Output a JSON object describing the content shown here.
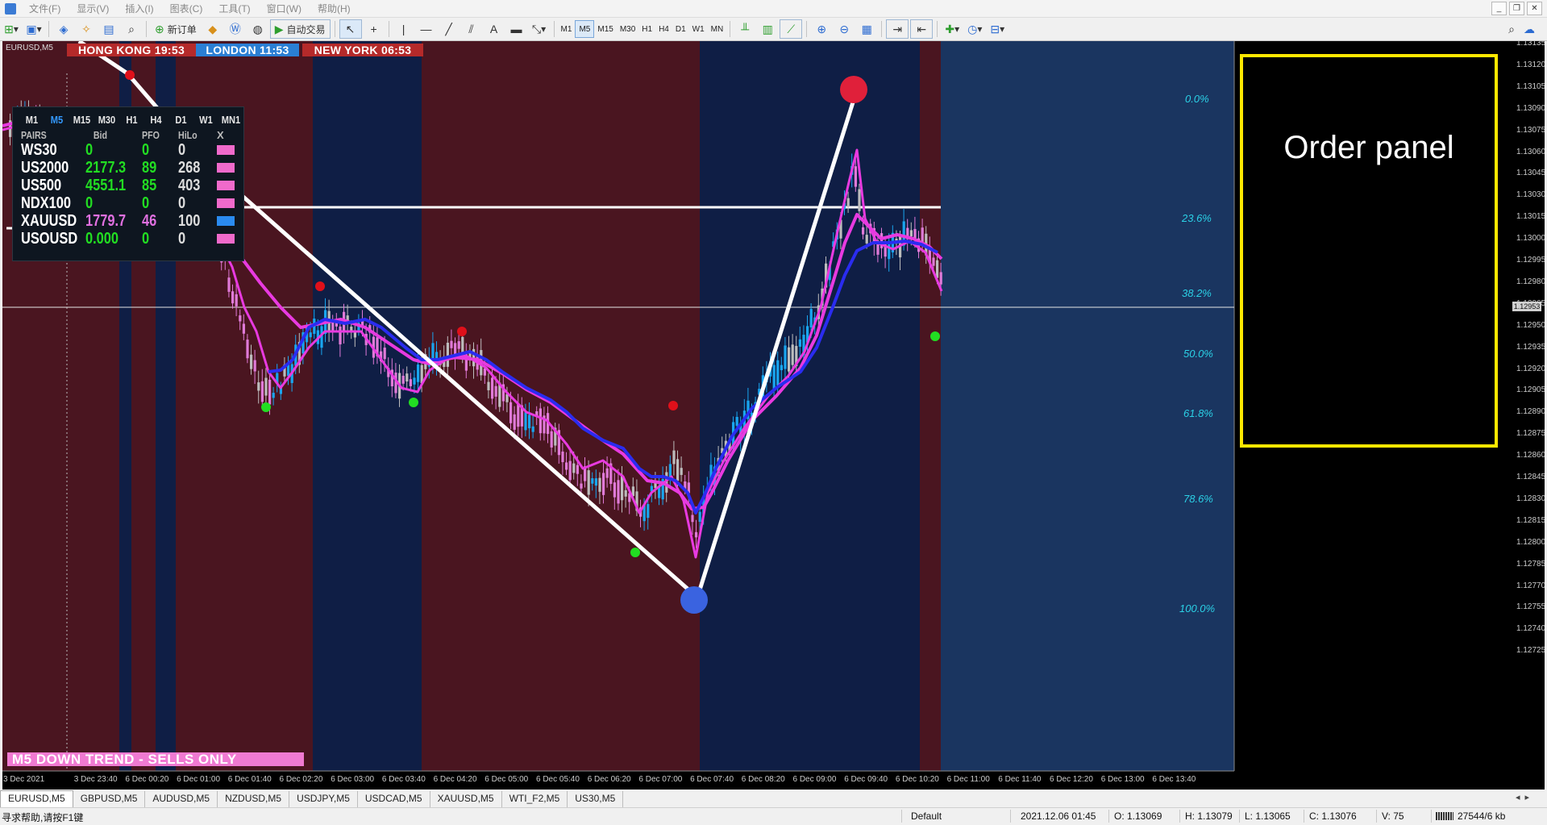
{
  "menu": [
    "文件(F)",
    "显示(V)",
    "插入(I)",
    "图表(C)",
    "工具(T)",
    "窗口(W)",
    "帮助(H)"
  ],
  "toolbar": {
    "new_order_label": "新订单",
    "auto_trade_label": "自动交易",
    "timeframes": [
      "M1",
      "M5",
      "M15",
      "M30",
      "H1",
      "H4",
      "D1",
      "W1",
      "MN"
    ],
    "active_timeframe": "M5"
  },
  "chart": {
    "symbol_label": "EURUSD,M5",
    "sessions": [
      {
        "label": "HONG KONG  19:53",
        "color": "#b52a2a"
      },
      {
        "label": "LONDON  11:53",
        "color": "#2a7fd4"
      },
      {
        "label": "NEW YORK  06:53",
        "color": "#b52a2a"
      }
    ],
    "order_panel_label": "Order panel",
    "trend_banner": "M5  DOWN TREND - SELLS ONLY",
    "fib_levels": [
      "0.0%",
      "23.6%",
      "38.2%",
      "50.0%",
      "61.8%",
      "78.6%",
      "100.0%"
    ],
    "price_axis": [
      "1.13135",
      "1.13120",
      "1.13105",
      "1.13090",
      "1.13075",
      "1.13060",
      "1.13045",
      "1.13030",
      "1.13015",
      "1.13000",
      "1.12995",
      "1.12980",
      "1.12965",
      "1.12950",
      "1.12935",
      "1.12920",
      "1.12905",
      "1.12890",
      "1.12875",
      "1.12860",
      "1.12845",
      "1.12830",
      "1.12815",
      "1.12800",
      "1.12785",
      "1.12770",
      "1.12755",
      "1.12740",
      "1.12725"
    ],
    "current_price": "1.12953",
    "time_axis": [
      "3 Dec 2021",
      "3 Dec 23:40",
      "6 Dec 00:20",
      "6 Dec 01:00",
      "6 Dec 01:40",
      "6 Dec 02:20",
      "6 Dec 03:00",
      "6 Dec 03:40",
      "6 Dec 04:20",
      "6 Dec 05:00",
      "6 Dec 05:40",
      "6 Dec 06:20",
      "6 Dec 07:00",
      "6 Dec 07:40",
      "6 Dec 08:20",
      "6 Dec 09:00",
      "6 Dec 09:40",
      "6 Dec 10:20",
      "6 Dec 11:00",
      "6 Dec 11:40",
      "6 Dec 12:20",
      "6 Dec 13:00",
      "6 Dec 13:40"
    ]
  },
  "overview": {
    "timeframes": [
      "M1",
      "M5",
      "M15",
      "M30",
      "H1",
      "H4",
      "D1",
      "W1",
      "MN1"
    ],
    "active_timeframe": "M5",
    "headers": {
      "pairs": "PAIRS",
      "bid": "Bid",
      "pfo": "PFO",
      "hilo": "HiLo",
      "x": "X"
    },
    "rows": [
      {
        "pair": "WS30",
        "bid": "0",
        "pfo": "0",
        "hilo": "0",
        "bid_color": "#22dd22",
        "pfo_color": "#22dd22",
        "x_color": "#f06acb"
      },
      {
        "pair": "US2000",
        "bid": "2177.3",
        "pfo": "89",
        "hilo": "268",
        "bid_color": "#22dd22",
        "pfo_color": "#22dd22",
        "x_color": "#f06acb"
      },
      {
        "pair": "US500",
        "bid": "4551.1",
        "pfo": "85",
        "hilo": "403",
        "bid_color": "#22dd22",
        "pfo_color": "#22dd22",
        "x_color": "#f06acb"
      },
      {
        "pair": "NDX100",
        "bid": "0",
        "pfo": "0",
        "hilo": "0",
        "bid_color": "#22dd22",
        "pfo_color": "#22dd22",
        "x_color": "#f06acb"
      },
      {
        "pair": "XAUUSD",
        "bid": "1779.7",
        "pfo": "46",
        "hilo": "100",
        "bid_color": "#e070e0",
        "pfo_color": "#e070e0",
        "x_color": "#2a8bf0"
      },
      {
        "pair": "USOUSD",
        "bid": "0.000",
        "pfo": "0",
        "hilo": "0",
        "bid_color": "#22dd22",
        "pfo_color": "#22dd22",
        "x_color": "#f06acb"
      }
    ]
  },
  "tabs": [
    "EURUSD,M5",
    "GBPUSD,M5",
    "AUDUSD,M5",
    "NZDUSD,M5",
    "USDJPY,M5",
    "USDCAD,M5",
    "XAUUSD,M5",
    "WTI_F2,M5",
    "US30,M5"
  ],
  "status": {
    "help": "寻求帮助,请按F1键",
    "profile": "Default",
    "datetime": "2021.12.06 01:45",
    "open": "O: 1.13069",
    "high": "H: 1.13079",
    "low": "L: 1.13065",
    "close": "C: 1.13076",
    "volume": "V: 75",
    "traffic": "27544/6 kb"
  },
  "colors": {
    "session_red": "#4a1520",
    "session_blue": "#0f1e45",
    "right_zone": "#1a3560",
    "bull_candle": "#19a6f0",
    "bear_candle": "#e07ad8",
    "neutral_candle": "#bdbdbd",
    "ma_fast": "#e83ae0",
    "ma_slow": "#2a2cf0",
    "zigzag": "#ffffff"
  }
}
